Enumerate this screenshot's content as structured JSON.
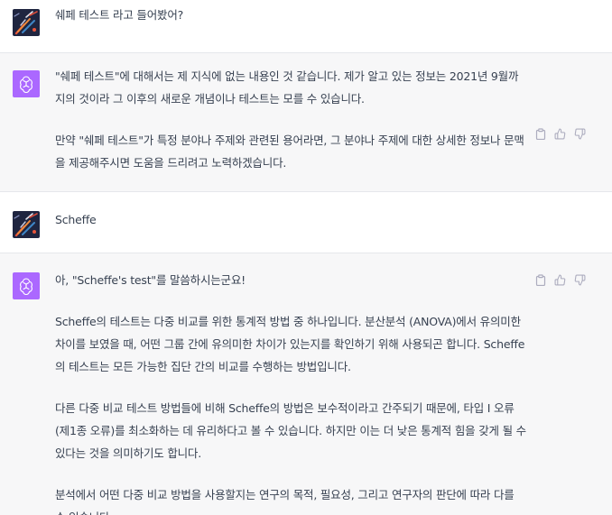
{
  "messages": [
    {
      "role": "user",
      "text": "쉐페 테스트 라고 들어봤어?"
    },
    {
      "role": "assistant",
      "paragraphs": [
        "\"쉐페 테스트\"에 대해서는 제 지식에 없는 내용인 것 같습니다. 제가 알고 있는 정보는 2021년 9월까지의 것이라 그 이후의 새로운 개념이나 테스트는 모를 수 있습니다.",
        "만약 \"쉐페 테스트\"가 특정 분야나 주제와 관련된 용어라면, 그 분야나 주제에 대한 상세한 정보나 문맥을 제공해주시면 도움을 드리려고 노력하겠습니다."
      ]
    },
    {
      "role": "user",
      "text": "Scheffe"
    },
    {
      "role": "assistant",
      "paragraphs": [
        "아, \"Scheffe's test\"를 말씀하시는군요!",
        "Scheffe의 테스트는 다중 비교를 위한 통계적 방법 중 하나입니다. 분산분석 (ANOVA)에서 유의미한 차이를 보였을 때, 어떤 그룹 간에 유의미한 차이가 있는지를 확인하기 위해 사용되곤 합니다. Scheffe의 테스트는 모든 가능한 집단 간의 비교를 수행하는 방법입니다.",
        "다른 다중 비교 테스트 방법들에 비해 Scheffe의 방법은 보수적이라고 간주되기 때문에, 타입 I 오류 (제1종 오류)를 최소화하는 데 유리하다고 볼 수 있습니다. 하지만 이는 더 낮은 통계적 힘을 갖게 될 수 있다는 것을 의미하기도 합니다.",
        "분석에서 어떤 다중 비교 방법을 사용할지는 연구의 목적, 필요성, 그리고 연구자의 판단에 따라 다를 수 있습니다."
      ]
    }
  ],
  "icons": {
    "user_avatar": "user-avatar-art",
    "assistant_avatar": "openai-logo",
    "copy": "clipboard-icon",
    "like": "thumbs-up-icon",
    "dislike": "thumbs-down-icon"
  },
  "colors": {
    "assistant_bg": "#f7f7f8",
    "user_bg": "#ffffff",
    "gpt_avatar": "#ab68ff",
    "user_avatar_bg": "#1f2540",
    "text": "#374151",
    "icon": "#acacbe"
  }
}
